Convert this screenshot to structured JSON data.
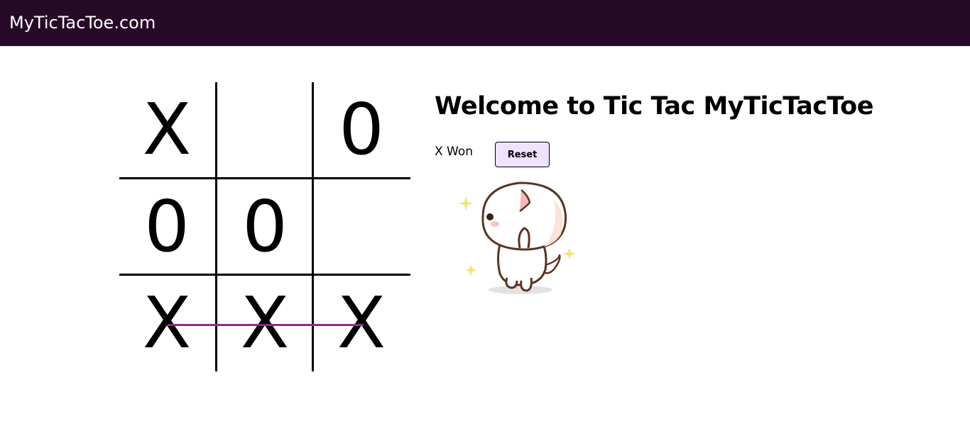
{
  "navbar": {
    "brand": "MyTicTacToe.com",
    "background": "#270a28"
  },
  "board": {
    "cells": [
      "X",
      "",
      "0",
      "0",
      "0",
      "",
      "X",
      "X",
      "X"
    ],
    "winning_row": 3,
    "win_line_color": "#8e2a8f"
  },
  "game_info": {
    "title": "Welcome to Tic Tac MyTicTacToe",
    "status": "X Won",
    "reset_label": "Reset",
    "reset_bg": "#eee2ff"
  },
  "celebration": {
    "icon": "dancing-cat-icon"
  }
}
